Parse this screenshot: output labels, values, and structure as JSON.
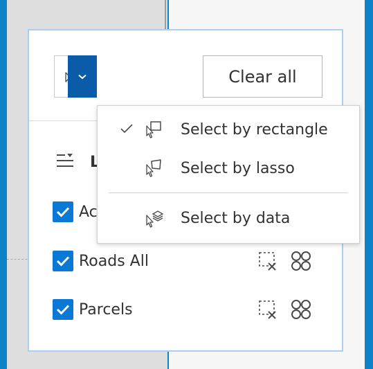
{
  "toolbar": {
    "mode_icon": "select-rectangle-icon",
    "dropdown_icon": "chevron-down-icon",
    "clear_label": "Clear all"
  },
  "layers": {
    "title": "L",
    "icon": "list-options-icon",
    "items": [
      {
        "label": "Ac",
        "checked": true
      },
      {
        "label": "Roads All",
        "checked": true
      },
      {
        "label": "Parcels",
        "checked": true
      }
    ]
  },
  "menu": {
    "items": [
      {
        "label": "Select by rectangle",
        "icon": "select-rectangle-icon",
        "selected": true
      },
      {
        "label": "Select by lasso",
        "icon": "select-lasso-icon",
        "selected": false
      },
      {
        "label": "Select by data",
        "icon": "select-data-icon",
        "selected": false
      }
    ]
  },
  "colors": {
    "accent": "#0a5ca8",
    "checkbox": "#0a79d6",
    "background": "#0e82c9"
  }
}
